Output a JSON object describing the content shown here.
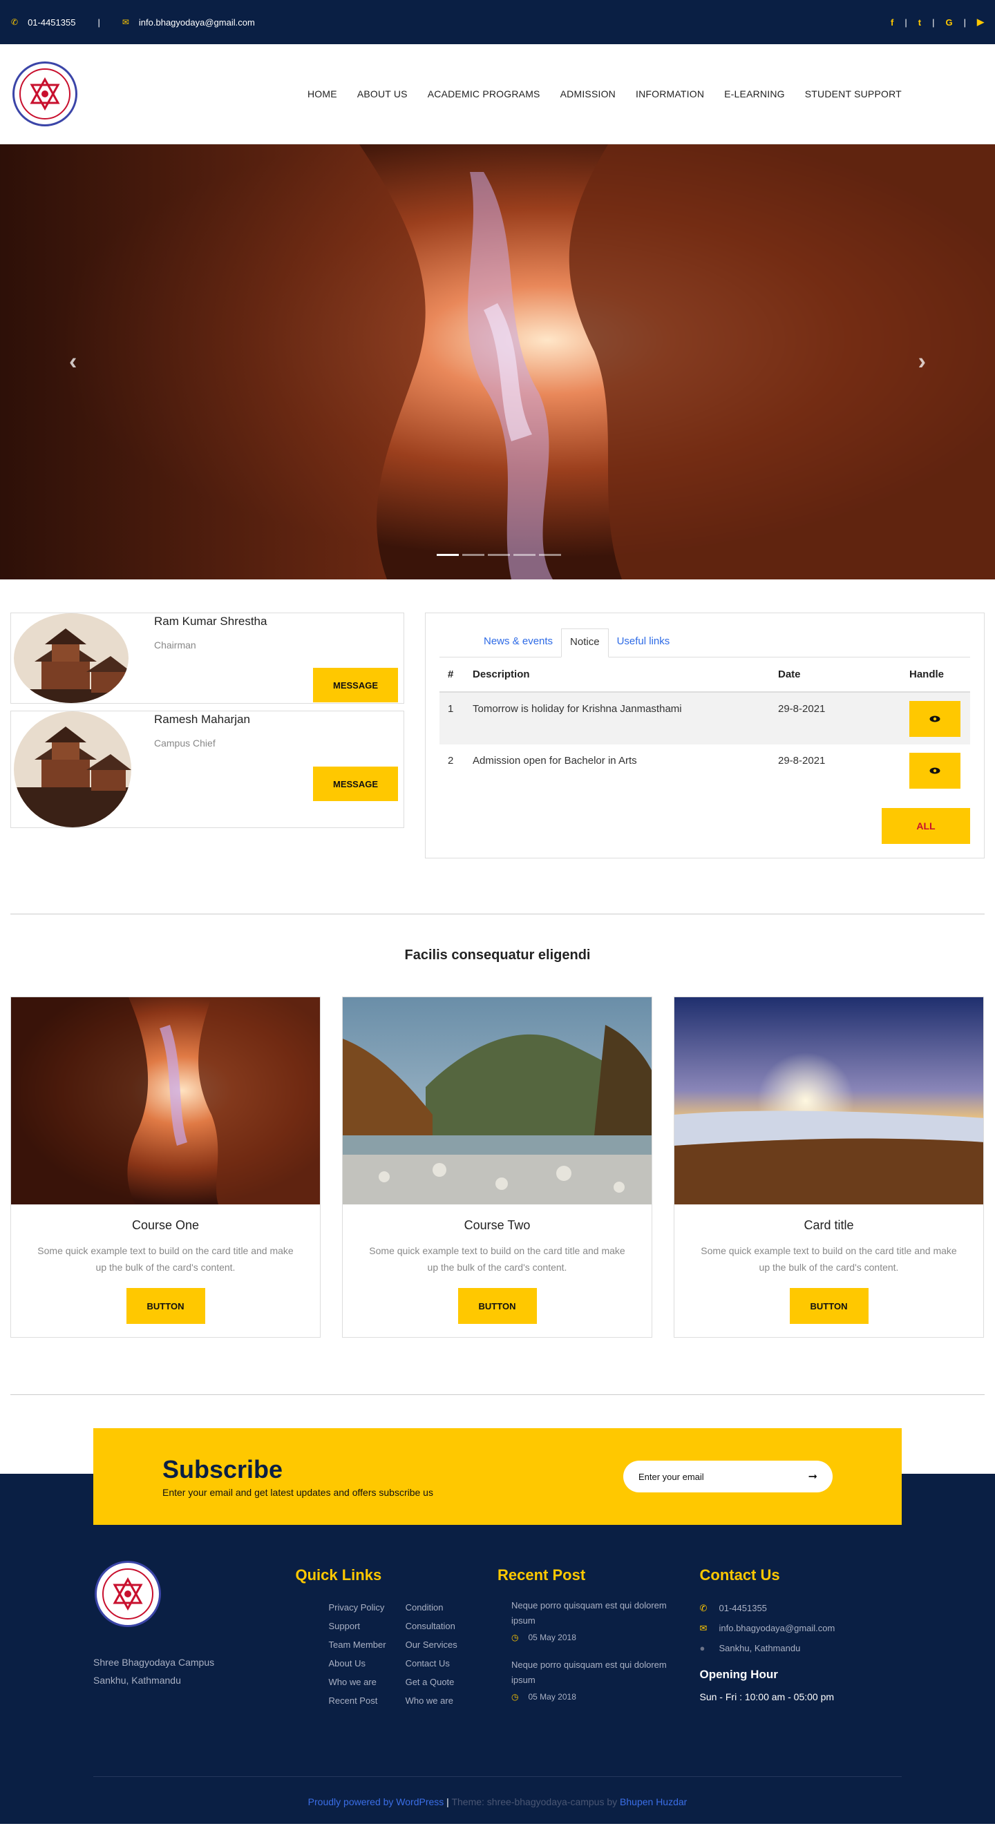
{
  "topbar": {
    "phone": "01-4451355",
    "separator": "|",
    "email": "info.bhagyodaya@gmail.com",
    "social": [
      "f",
      "|",
      "t",
      "|",
      "G",
      "|",
      "yt"
    ]
  },
  "nav": {
    "items": [
      "HOME",
      "ABOUT US",
      "ACADEMIC PROGRAMS",
      "ADMISSION",
      "INFORMATION",
      "E-LEARNING",
      "STUDENT SUPPORT"
    ]
  },
  "hero": {
    "prev": "‹",
    "next": "›"
  },
  "people": [
    {
      "name": "Ram Kumar Shrestha",
      "role": "Chairman",
      "button": "MESSAGE"
    },
    {
      "name": "Ramesh Maharjan",
      "role": "Campus Chief",
      "button": "MESSAGE"
    }
  ],
  "notice": {
    "tabs": [
      "News & events",
      "Notice",
      "Useful links"
    ],
    "headers": [
      "#",
      "Description",
      "Date",
      "Handle"
    ],
    "rows": [
      {
        "n": "1",
        "desc": "Tomorrow is holiday for Krishna Janmasthami",
        "date": "29-8-2021"
      },
      {
        "n": "2",
        "desc": "Admission open for Bachelor in Arts",
        "date": "29-8-2021"
      }
    ],
    "all_label": "ALL"
  },
  "courses": {
    "title": "Facilis consequatur eligendi",
    "cards": [
      {
        "title": "Course One",
        "text": "Some quick example text to build on the card title and make up the bulk of the card's content.",
        "button": "BUTTON"
      },
      {
        "title": "Course Two",
        "text": "Some quick example text to build on the card title and make up the bulk of the card's content.",
        "button": "BUTTON"
      },
      {
        "title": "Card title",
        "text": "Some quick example text to build on the card title and make up the bulk of the card's content.",
        "button": "BUTTON"
      }
    ]
  },
  "subscribe": {
    "title": "Subscribe",
    "subtitle": "Enter your email and get latest updates and offers subscribe us",
    "placeholder": "Enter your email",
    "arrow": "➞"
  },
  "footer": {
    "address_line1": "Shree Bhagyodaya Campus",
    "address_line2": "Sankhu, Kathmandu",
    "quick_links_title": "Quick Links",
    "quick_links_col1": [
      "Privacy Policy",
      "Support",
      "Team Member",
      "About Us",
      "Who we are",
      "Recent Post"
    ],
    "quick_links_col2": [
      "Condition",
      "Consultation",
      "Our Services",
      "Contact Us",
      "Get a Quote",
      "Who we are"
    ],
    "recent_title": "Recent Post",
    "posts": [
      {
        "title": "Neque porro quisquam est qui dolorem ipsum",
        "date": "05 May 2018"
      },
      {
        "title": "Neque porro quisquam est qui dolorem ipsum",
        "date": "05 May 2018"
      }
    ],
    "contact_title": "Contact Us",
    "contact_phone": "01-4451355",
    "contact_email": "info.bhagyodaya@gmail.com",
    "contact_address": "Sankhu, Kathmandu",
    "opening_title": "Opening Hour",
    "opening_text": "Sun - Fri : 10:00 am - 05:00 pm",
    "copy_powered": "Proudly powered by WordPress",
    "copy_sep": " | ",
    "copy_theme": "Theme: shree-bhagyodaya-campus by ",
    "copy_author": "Bhupen Huzdar"
  },
  "colors": {
    "navy": "#0a1f44",
    "accent": "#ffc800",
    "link": "#2e6be6"
  }
}
